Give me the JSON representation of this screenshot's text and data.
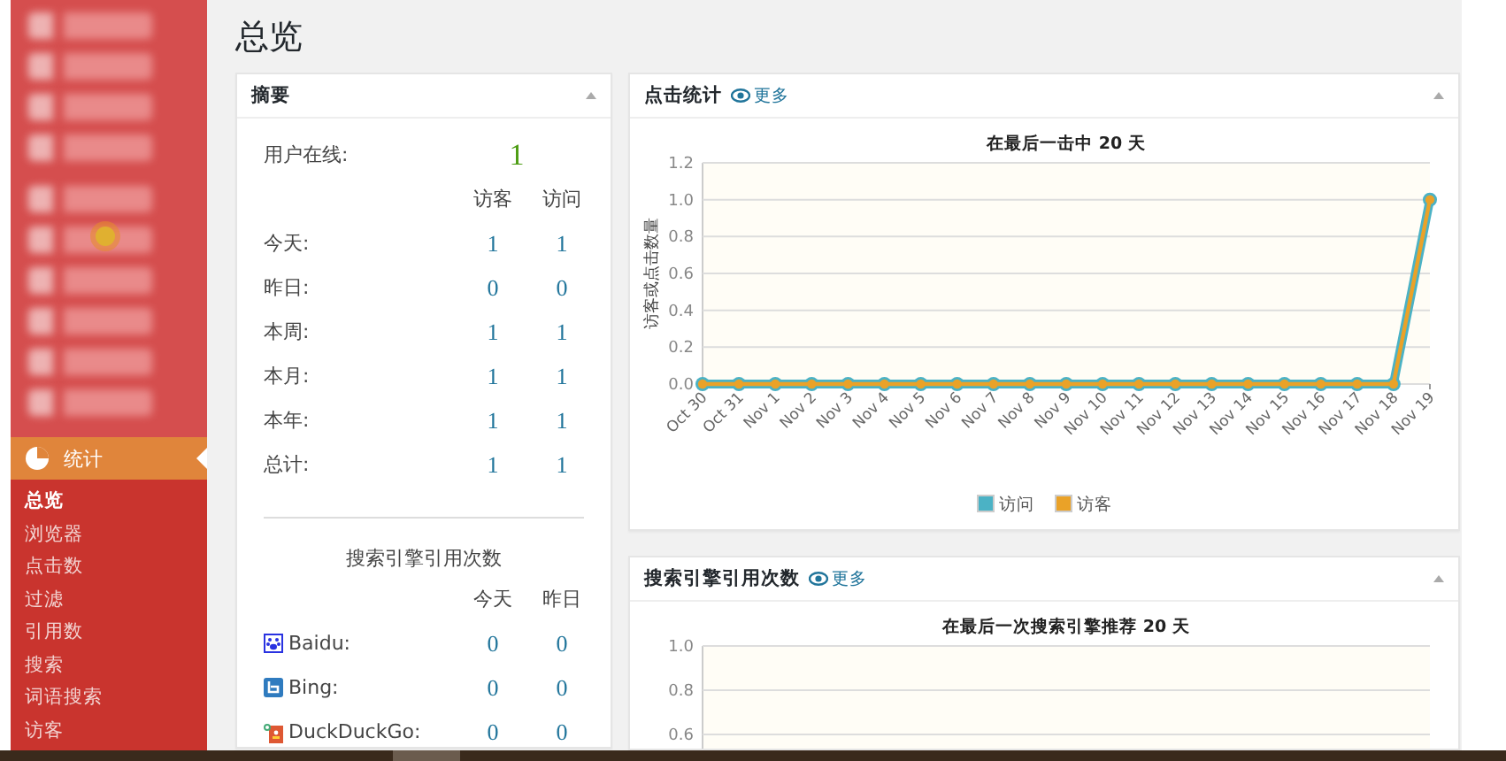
{
  "sidebar": {
    "active_menu": {
      "label": "统计",
      "selected": true
    },
    "submenu": [
      {
        "label": "总览",
        "selected": true
      },
      {
        "label": "浏览器",
        "selected": false
      },
      {
        "label": "点击数",
        "selected": false
      },
      {
        "label": "过滤",
        "selected": false
      },
      {
        "label": "引用数",
        "selected": false
      },
      {
        "label": "搜索",
        "selected": false
      },
      {
        "label": "词语搜索",
        "selected": false
      },
      {
        "label": "访客",
        "selected": false
      }
    ]
  },
  "page_title": "总览",
  "summary": {
    "title": "摘要",
    "online_label": "用户在线:",
    "online_value": "1",
    "columns": [
      "访客",
      "访问"
    ],
    "rows": [
      {
        "label": "今天:",
        "visitors": "1",
        "visits": "1"
      },
      {
        "label": "昨日:",
        "visitors": "0",
        "visits": "0"
      },
      {
        "label": "本周:",
        "visitors": "1",
        "visits": "1"
      },
      {
        "label": "本月:",
        "visitors": "1",
        "visits": "1"
      },
      {
        "label": "本年:",
        "visitors": "1",
        "visits": "1"
      },
      {
        "label": "总计:",
        "visitors": "1",
        "visits": "1"
      }
    ],
    "search_title": "搜索引擎引用次数",
    "search_columns": [
      "今天",
      "昨日"
    ],
    "engines": [
      {
        "kind": "baidu",
        "name": "Baidu:",
        "today": "0",
        "yesterday": "0"
      },
      {
        "kind": "bing",
        "name": "Bing:",
        "today": "0",
        "yesterday": "0"
      },
      {
        "kind": "duckduckgo",
        "name": "DuckDuckGo:",
        "today": "0",
        "yesterday": "0"
      }
    ]
  },
  "panels": [
    {
      "title": "点击统计",
      "more": "更多",
      "chart_data": {
        "type": "line",
        "title": "在最后一击中 20 天",
        "ylabel": "访客或点击数量",
        "categories": [
          "Oct 30",
          "Oct 31",
          "Nov 1",
          "Nov 2",
          "Nov 3",
          "Nov 4",
          "Nov 5",
          "Nov 6",
          "Nov 7",
          "Nov 8",
          "Nov 9",
          "Nov 10",
          "Nov 11",
          "Nov 12",
          "Nov 13",
          "Nov 14",
          "Nov 15",
          "Nov 16",
          "Nov 17",
          "Nov 18",
          "Nov 19"
        ],
        "series": [
          {
            "name": "访问",
            "color": "#4bb2c5",
            "marker": true,
            "values": [
              0,
              0,
              0,
              0,
              0,
              0,
              0,
              0,
              0,
              0,
              0,
              0,
              0,
              0,
              0,
              0,
              0,
              0,
              0,
              0,
              1
            ]
          },
          {
            "name": "访客",
            "color": "#eaa228",
            "marker": true,
            "values": [
              0,
              0,
              0,
              0,
              0,
              0,
              0,
              0,
              0,
              0,
              0,
              0,
              0,
              0,
              0,
              0,
              0,
              0,
              0,
              0,
              1
            ]
          }
        ],
        "grid": true,
        "legend": true,
        "ylim": [
          0,
          1.2
        ],
        "yticks": [
          {
            "value": 0,
            "label": "0.0"
          },
          {
            "value": 0.2,
            "label": "0.2"
          },
          {
            "value": 0.4,
            "label": "0.4"
          },
          {
            "value": 0.6,
            "label": "0.6"
          },
          {
            "value": 0.8,
            "label": "0.8"
          },
          {
            "value": 1,
            "label": "1.0"
          },
          {
            "value": 1.2,
            "label": "1.2"
          }
        ]
      }
    },
    {
      "title": "搜索引擎引用次数",
      "more": "更多",
      "chart_data": {
        "type": "line",
        "title": "在最后一次搜索引擎推荐 20 天",
        "grid": true,
        "categories": [
          null,
          null,
          null,
          null,
          null,
          null,
          null,
          null,
          null,
          null,
          null,
          null,
          null,
          null,
          null,
          null,
          null,
          null,
          null,
          null,
          null
        ],
        "ylim": [
          0,
          1
        ],
        "yticks": [
          {
            "value": 0.6,
            "label": "0.6"
          },
          {
            "value": 0.8,
            "label": "0.8"
          },
          {
            "value": 1,
            "label": "1.0"
          }
        ]
      }
    }
  ]
}
